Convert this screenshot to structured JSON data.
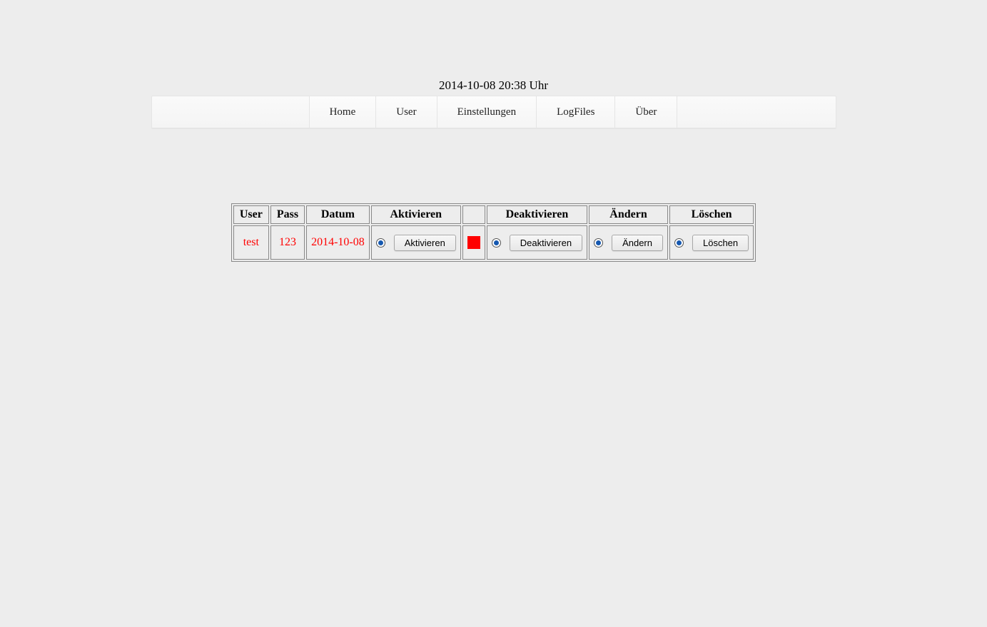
{
  "timestamp": "2014-10-08 20:38 Uhr",
  "nav": {
    "home": "Home",
    "user": "User",
    "settings": "Einstellungen",
    "logfiles": "LogFiles",
    "about": "Über"
  },
  "table": {
    "headers": {
      "user": "User",
      "pass": "Pass",
      "datum": "Datum",
      "aktivieren": "Aktivieren",
      "status": "",
      "deaktivieren": "Deaktivieren",
      "aendern": "Ändern",
      "loeschen": "Löschen"
    },
    "row": {
      "user": "test",
      "pass": "123",
      "datum": "2014-10-08",
      "btn_aktivieren": "Aktivieren",
      "btn_deaktivieren": "Deaktivieren",
      "btn_aendern": "Ändern",
      "btn_loeschen": "Löschen",
      "status_color": "#ff0000"
    }
  }
}
